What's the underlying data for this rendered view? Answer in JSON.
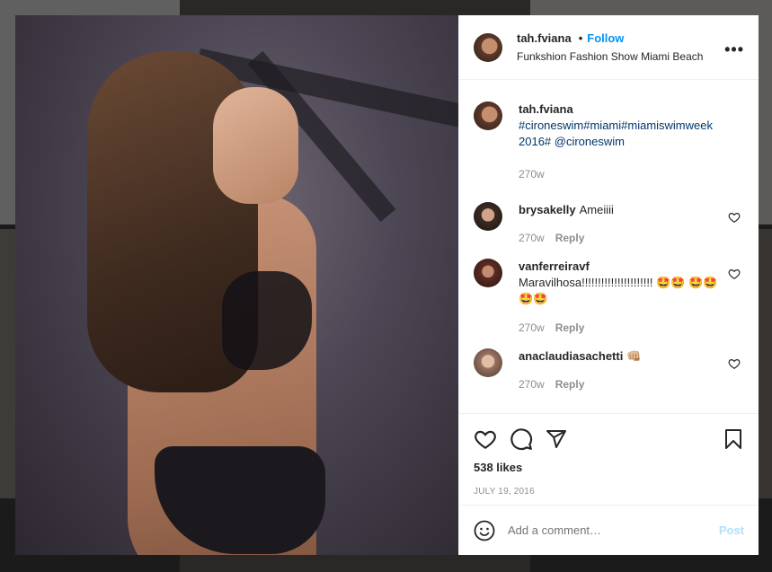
{
  "post": {
    "username": "tah.fviana",
    "follow_label": "Follow",
    "dot": "•",
    "location": "Funkshion Fashion Show Miami Beach",
    "more_icon": "more-horizontal-icon",
    "more_label": "•••"
  },
  "caption": {
    "username": "tah.fviana",
    "text": "#cironeswim#miami#miamiswimweek 2016# @cironeswim",
    "time": "270w"
  },
  "comments": [
    {
      "username": "brysakelly",
      "text": "Ameiiii",
      "time": "270w",
      "reply_label": "Reply"
    },
    {
      "username": "vanferreiravf",
      "text": "Maravilhosa!!!!!!!!!!!!!!!!!!!!!! 🤩🤩 🤩🤩🤩🤩",
      "time": "270w",
      "reply_label": "Reply"
    },
    {
      "username": "anaclaudiasachetti",
      "text": "👊🏼",
      "time": "270w",
      "reply_label": "Reply"
    }
  ],
  "actions": {
    "likes": "538 likes",
    "date": "JULY 19, 2016",
    "icons": [
      "heart-icon",
      "comment-icon",
      "share-icon",
      "bookmark-icon"
    ]
  },
  "add_comment": {
    "placeholder": "Add a comment…",
    "post_label": "Post",
    "emoji_icon": "smiley-icon"
  },
  "colors": {
    "link_blue": "#0095f6",
    "hashtag": "#00376b",
    "muted": "#8e8e8e",
    "post_disabled": "#b2dffc"
  }
}
